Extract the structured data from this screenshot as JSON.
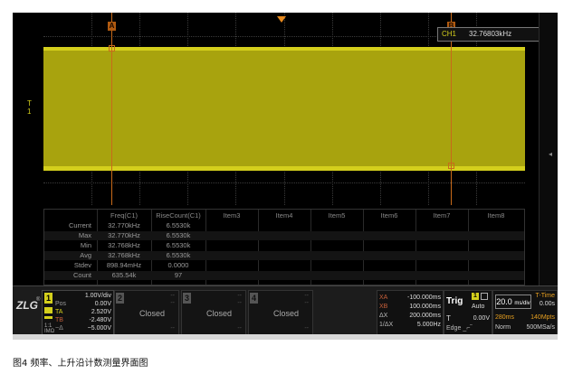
{
  "plot": {
    "cursor_a_label": "A",
    "cursor_b_label": "B",
    "channel_marker": "T",
    "channel_marker_sub": "1",
    "readout_channel": "CH1",
    "readout_value": "32.76803kHz"
  },
  "table": {
    "headers": [
      "Freq(C1)",
      "RiseCount(C1)",
      "Item3",
      "Item4",
      "Item5",
      "Item6",
      "Item7",
      "Item8"
    ],
    "rows": [
      {
        "label": "Current",
        "freq": "32.770kHz",
        "rise": "6.5530k"
      },
      {
        "label": "Max",
        "freq": "32.770kHz",
        "rise": "6.5530k"
      },
      {
        "label": "Min",
        "freq": "32.768kHz",
        "rise": "6.5530k"
      },
      {
        "label": "Avg",
        "freq": "32.768kHz",
        "rise": "6.5530k"
      },
      {
        "label": "Stdev",
        "freq": "898.94mHz",
        "rise": "0.0000"
      },
      {
        "label": "Count",
        "freq": "635.54k",
        "rise": "97"
      }
    ]
  },
  "controls": {
    "logo": "ZLG",
    "logo_mark": "®",
    "ch1": {
      "num": "1",
      "scale": "1.00V/div",
      "pos_label": "Pos",
      "pos": "0.00V",
      "ta_label": "TA",
      "ta": "2.520V",
      "tb_label": "TB",
      "tb": "-2.480V",
      "delta_label": "~Δ",
      "delta": "~5.000V",
      "side1": "1:1",
      "side2": "IMΩ"
    },
    "closed_channels": [
      {
        "num": "2",
        "status": "Closed"
      },
      {
        "num": "3",
        "status": "Closed"
      },
      {
        "num": "4",
        "status": "Closed"
      }
    ],
    "dash": "--",
    "horizontal": [
      {
        "k": "XA",
        "v": "-100.000ms"
      },
      {
        "k": "XB",
        "v": "100.000ms"
      },
      {
        "k": "ΔX",
        "v": "200.000ms"
      },
      {
        "k": "1/ΔX",
        "v": "5.000Hz"
      }
    ],
    "trigger": {
      "label": "Trig",
      "channel": "1",
      "mode": "Auto",
      "t_label": "T",
      "level": "0.00V",
      "edge": "Edge"
    },
    "timebase": {
      "value": "20.0",
      "unit": "ms/div",
      "title": "T-Time",
      "ttime": "0.00s",
      "mem": "280ms",
      "rate_top": "140Mpts",
      "mode": "Norm",
      "rate": "500MSa/s"
    }
  },
  "caption": "图4 频率、上升沿计数测量界面图",
  "colors": {
    "trace": "#d4cf1c",
    "trace_fill": "#a8a30e",
    "cursor": "#c86a1a",
    "trigger_marker": "#e88a1e"
  }
}
